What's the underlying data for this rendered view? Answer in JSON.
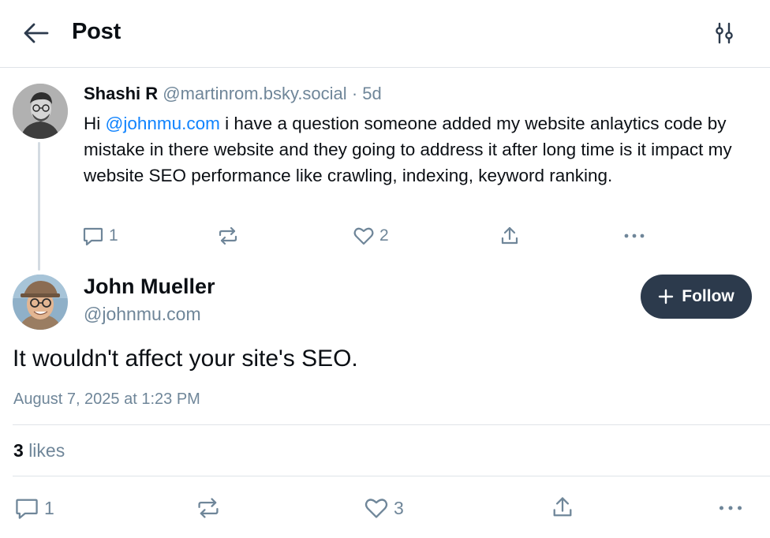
{
  "header": {
    "title": "Post",
    "back_icon": "arrow-left-icon",
    "filter_icon": "sliders-icon"
  },
  "parent_post": {
    "author_name": "Shashi R",
    "author_handle": "@martinrom.bsky.social",
    "separator": "·",
    "age": "5d",
    "text_before": "Hi ",
    "mention": "@johnmu.com",
    "text_after": " i have a question someone added my website anlaytics code by mistake in there website and they going to address it after long time is it impact my website SEO performance like crawling, indexing, keyword ranking.",
    "reply_count": "1",
    "like_count": "2"
  },
  "main_post": {
    "author_name": "John Mueller",
    "author_handle": "@johnmu.com",
    "follow_label": "Follow",
    "text": "It wouldn't affect your site's SEO.",
    "timestamp": "August 7, 2025 at 1:23 PM",
    "likes_count": "3",
    "likes_label": "likes",
    "reply_count": "1",
    "like_count": "3"
  },
  "colors": {
    "muted": "#6f8699",
    "mention": "#1083fe",
    "follow_bg": "#2c3a4c",
    "divider": "#dfe3e8"
  }
}
